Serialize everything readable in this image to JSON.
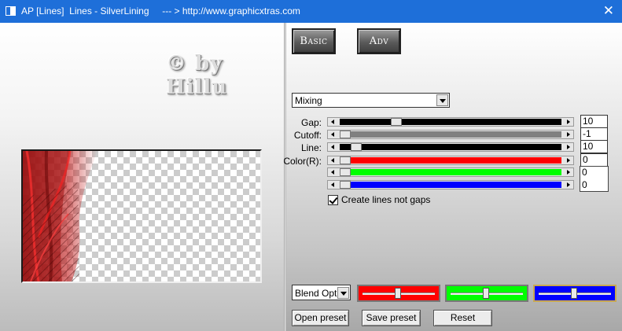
{
  "window": {
    "title": "AP [Lines]  Lines - SilverLining     --- > http://www.graphicxtras.com",
    "close_glyph": "✕"
  },
  "watermark": {
    "line1": "© by",
    "line2": "Hillu"
  },
  "tabs": {
    "basic_label": "Basic",
    "adv_label": "Adv"
  },
  "mode_dropdown": {
    "value": "Mixing"
  },
  "sliders": [
    {
      "label": "Gap:",
      "value": "10",
      "fill": "#000000",
      "thumb_fraction": 0.24
    },
    {
      "label": "Cutoff:",
      "value": "-1",
      "fill": "#808080",
      "thumb_fraction": 0.0
    },
    {
      "label": "Line:",
      "value": "10",
      "fill": "#000000",
      "thumb_fraction": 0.05
    },
    {
      "label": "Color(R):",
      "value": "0",
      "fill": "#ff0000",
      "thumb_fraction": 0.0
    },
    {
      "label": "",
      "value": "0",
      "fill": "#00ff00",
      "thumb_fraction": 0.0
    },
    {
      "label": "",
      "value": "0",
      "fill": "#0000ff",
      "thumb_fraction": 0.0
    }
  ],
  "option": {
    "create_lines_label": "Create lines not gaps",
    "checked": true
  },
  "blend": {
    "value": "Blend Options"
  },
  "color_sliders": [
    {
      "name": "red",
      "color": "#ff0000",
      "fraction": 0.5
    },
    {
      "name": "green",
      "color": "#00ff00",
      "fraction": 0.5
    },
    {
      "name": "blue",
      "color": "#0000ff",
      "fraction": 0.5
    }
  ],
  "buttons": {
    "open_preset": "Open preset",
    "save_preset": "Save preset",
    "reset": "Reset"
  }
}
